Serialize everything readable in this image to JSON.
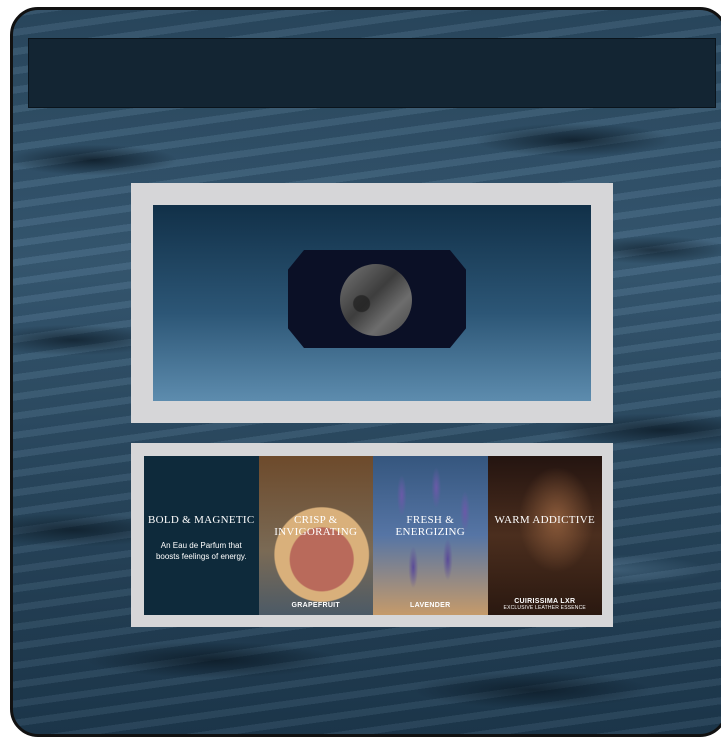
{
  "cards": [
    {
      "title": "BOLD & MAGNETIC",
      "subtitle": "An Eau de Parfum that boosts feelings of energy.",
      "label": "",
      "sublabel": ""
    },
    {
      "title": "CRISP & INVIGORATING",
      "subtitle": "",
      "label": "GRAPEFRUIT",
      "sublabel": ""
    },
    {
      "title": "FRESH & ENERGIZING",
      "subtitle": "",
      "label": "LAVENDER",
      "sublabel": ""
    },
    {
      "title": "WARM ADDICTIVE",
      "subtitle": "",
      "label": "CUIRISSIMA LXR",
      "sublabel": "EXCLUSIVE LEATHER ESSENCE"
    }
  ],
  "colors": {
    "topbar": "#132533",
    "panel": "#d6d6d8",
    "bottle": "#0b1026"
  }
}
